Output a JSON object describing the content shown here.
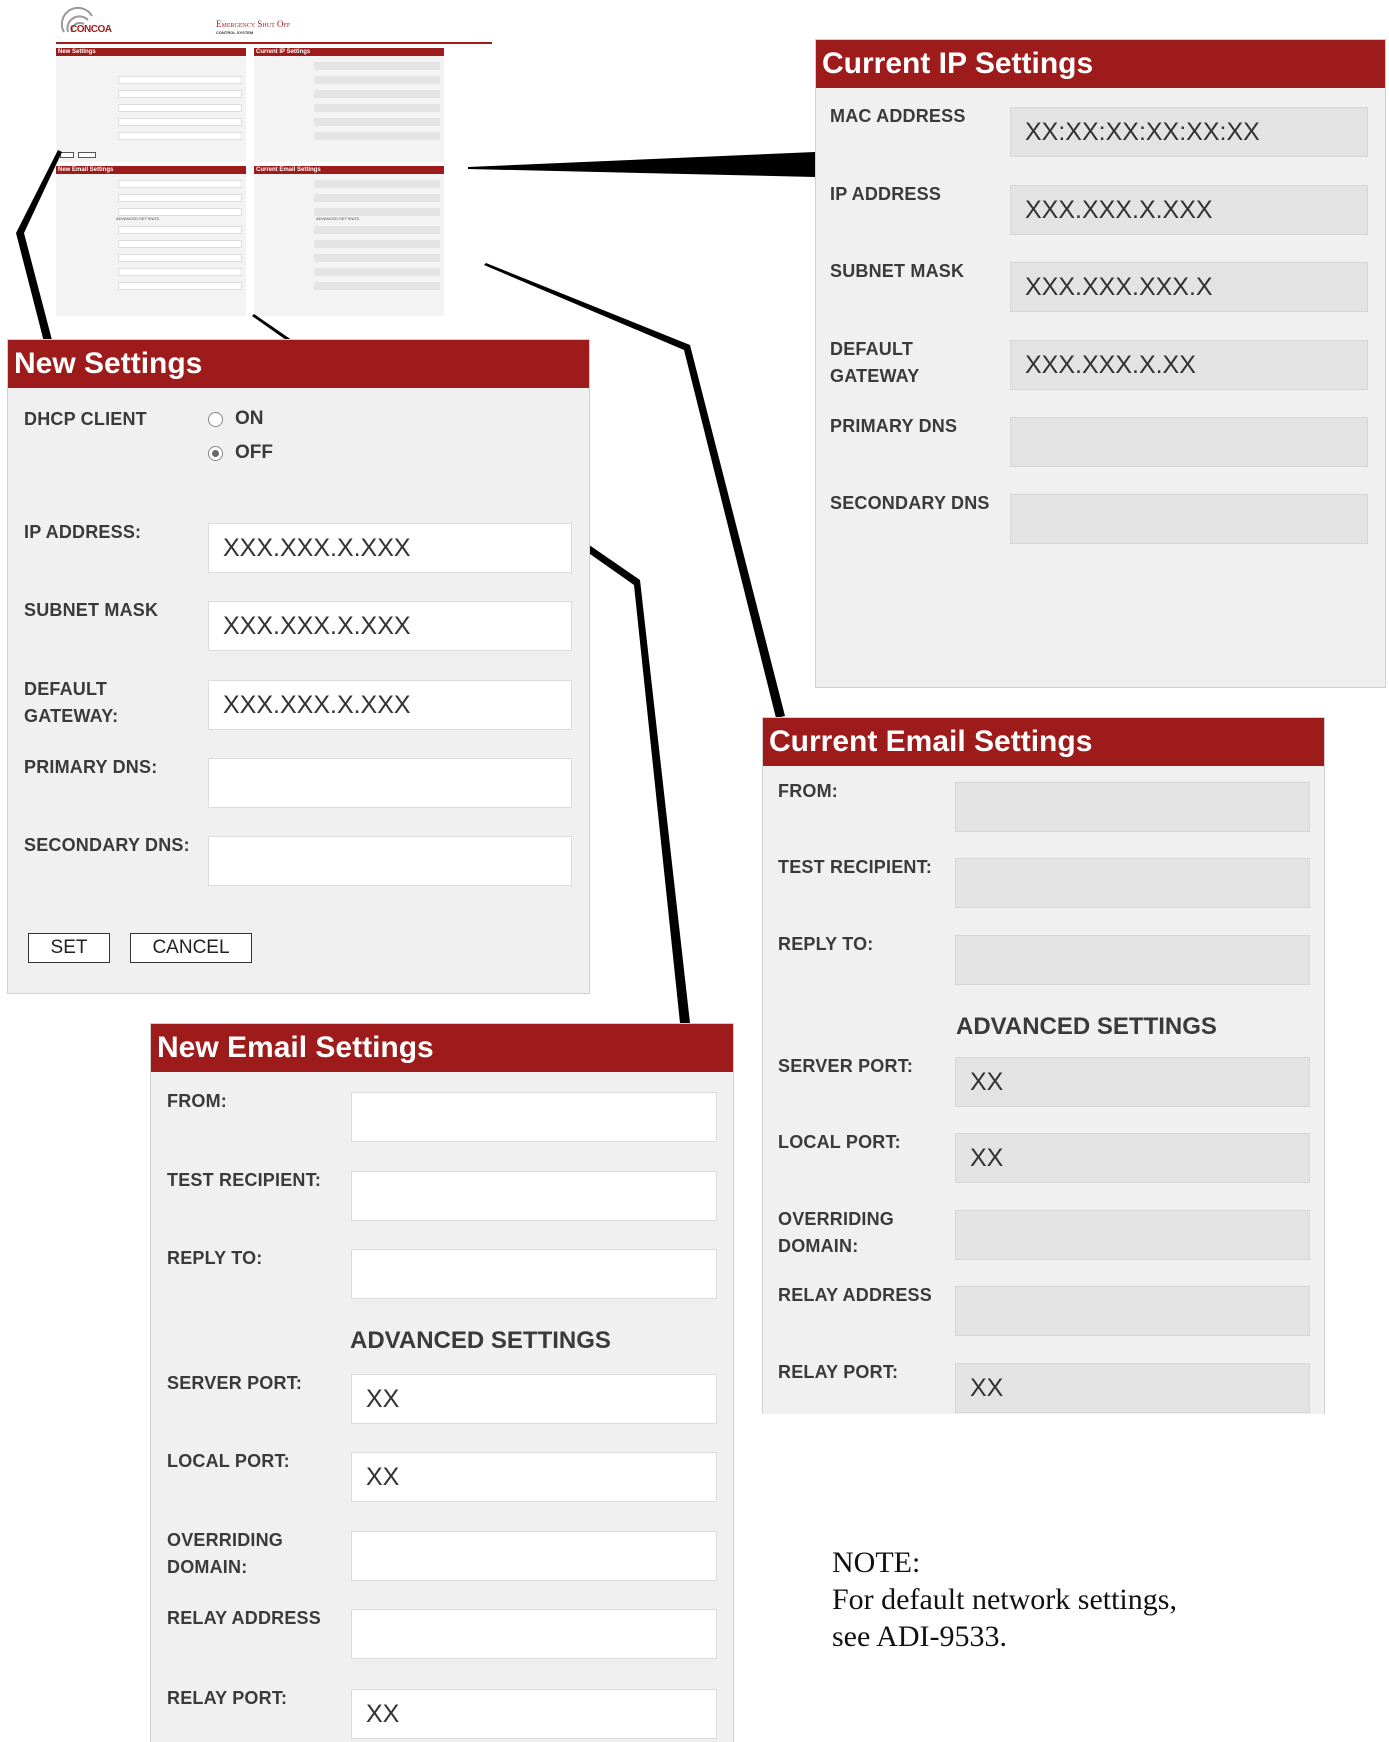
{
  "header": {
    "logo_text": "CONCOA",
    "title_line1": "Emergency Shut Off",
    "title_line2": "CONTROL SYSTEM"
  },
  "new_settings": {
    "title": "New Settings",
    "dhcp_label": "DHCP CLIENT",
    "dhcp_on": "ON",
    "dhcp_off": "OFF",
    "dhcp_selected": "OFF",
    "fields": [
      {
        "label": "IP ADDRESS:",
        "value": "XXX.XXX.X.XXX"
      },
      {
        "label": "SUBNET MASK",
        "value": "XXX.XXX.X.XXX"
      },
      {
        "label": "DEFAULT\nGATEWAY:",
        "value": "XXX.XXX.X.XXX"
      },
      {
        "label": "PRIMARY DNS:",
        "value": ""
      },
      {
        "label": "SECONDARY DNS:",
        "value": ""
      }
    ],
    "set_label": "SET",
    "cancel_label": "CANCEL"
  },
  "current_ip": {
    "title": "Current IP Settings",
    "fields": [
      {
        "label": "MAC ADDRESS",
        "value": "XX:XX:XX:XX:XX:XX"
      },
      {
        "label": "IP ADDRESS",
        "value": "XXX.XXX.X.XXX"
      },
      {
        "label": "SUBNET MASK",
        "value": "XXX.XXX.XXX.X"
      },
      {
        "label": "DEFAULT\nGATEWAY",
        "value": "XXX.XXX.X.XX"
      },
      {
        "label": "PRIMARY DNS",
        "value": ""
      },
      {
        "label": "SECONDARY DNS",
        "value": ""
      }
    ]
  },
  "current_email": {
    "title": "Current Email Settings",
    "advanced_label": "ADVANCED SETTINGS",
    "fields": [
      {
        "label": "FROM:",
        "value": ""
      },
      {
        "label": "TEST RECIPIENT:",
        "value": ""
      },
      {
        "label": "REPLY TO:",
        "value": ""
      },
      {
        "label": "SERVER PORT:",
        "value": "XX"
      },
      {
        "label": "LOCAL PORT:",
        "value": "XX"
      },
      {
        "label": "OVERRIDING\nDOMAIN:",
        "value": ""
      },
      {
        "label": "RELAY ADDRESS",
        "value": ""
      },
      {
        "label": "RELAY PORT:",
        "value": "XX"
      }
    ]
  },
  "new_email": {
    "title": "New Email Settings",
    "advanced_label": "ADVANCED SETTINGS",
    "fields": [
      {
        "label": "FROM:",
        "value": ""
      },
      {
        "label": "TEST RECIPIENT:",
        "value": ""
      },
      {
        "label": "REPLY TO:",
        "value": ""
      },
      {
        "label": "SERVER PORT:",
        "value": "XX"
      },
      {
        "label": "LOCAL PORT:",
        "value": "XX"
      },
      {
        "label": "OVERRIDING\nDOMAIN:",
        "value": ""
      },
      {
        "label": "RELAY ADDRESS",
        "value": ""
      },
      {
        "label": "RELAY PORT:",
        "value": "XX"
      }
    ]
  },
  "note": {
    "line1": "NOTE:",
    "line2": "For default network settings,",
    "line3": "see ADI-9533."
  },
  "colors": {
    "header_red": "#9e1b1b",
    "panel_bg": "#f0f0f0",
    "readonly_field": "#e3e3e3"
  }
}
